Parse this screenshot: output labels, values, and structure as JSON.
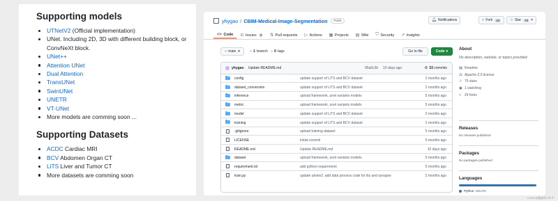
{
  "doc": {
    "heading_models": "Supporting models",
    "models": [
      {
        "link": "UTNetV2",
        "text": " (Official implementation)"
      },
      {
        "link": "",
        "text": "UNet. Including 2D, 3D with different building block, or ConvNeXt block."
      },
      {
        "link": "UNet++",
        "text": ""
      },
      {
        "link": "Attention UNet",
        "text": ""
      },
      {
        "link": "Dual Attention",
        "text": ""
      },
      {
        "link": "TransUNet",
        "text": ""
      },
      {
        "link": "SwinUNet",
        "text": ""
      },
      {
        "link": "UNETR",
        "text": ""
      },
      {
        "link": "VT-UNet",
        "text": ""
      },
      {
        "link": "",
        "text": "More models are comming soon ..."
      }
    ],
    "heading_datasets": "Supporting Datasets",
    "datasets": [
      {
        "link": "ACDC",
        "text": " Cardiac MRI"
      },
      {
        "link": "BCV",
        "text": " Abdomen Organ CT"
      },
      {
        "link": "LiTS",
        "text": " Liver and Tumor CT"
      },
      {
        "link": "",
        "text": "More datasets are comming soon"
      }
    ]
  },
  "repo": {
    "owner": "yhygao",
    "separator": "/",
    "name": "CBIM-Medical-Image-Segmentation",
    "visibility": "Public",
    "actions": {
      "notifications": "Notifications",
      "fork": "Fork",
      "fork_count": "24",
      "star": "Star",
      "star_count": "70"
    },
    "tabs": [
      {
        "label": "Code",
        "icon": "<>",
        "count": ""
      },
      {
        "label": "Issues",
        "icon": "⊙",
        "count": "3"
      },
      {
        "label": "Pull requests",
        "icon": "⇅",
        "count": ""
      },
      {
        "label": "Actions",
        "icon": "▷",
        "count": ""
      },
      {
        "label": "Projects",
        "icon": "▦",
        "count": ""
      },
      {
        "label": "Wiki",
        "icon": "▤",
        "count": ""
      },
      {
        "label": "Security",
        "icon": "⛉",
        "count": ""
      },
      {
        "label": "Insights",
        "icon": "↗",
        "count": ""
      }
    ],
    "branch": "main",
    "branch_count": "1",
    "branch_word": "branch",
    "tag_count": "0",
    "tag_word": "tags",
    "goto_file": "Go to file",
    "code_button": "Code",
    "latest_commit": {
      "author": "yhygao",
      "message": "Update README.md",
      "hash": "95a5c2b",
      "ago": "10 days ago",
      "commits_count": "33",
      "commits_word": "commits"
    },
    "files": [
      {
        "type": "dir",
        "name": "config",
        "message": "update support of LiTS and BCV dataset",
        "age": "2 months ago"
      },
      {
        "type": "dir",
        "name": "dataset_conversion",
        "message": "update support of LiTS and BCV dataset",
        "age": "2 months ago"
      },
      {
        "type": "dir",
        "name": "inference",
        "message": "upload framework, unet variants models",
        "age": "5 months ago"
      },
      {
        "type": "dir",
        "name": "metric",
        "message": "upload framework, unet variants models",
        "age": "5 months ago"
      },
      {
        "type": "dir",
        "name": "model",
        "message": "update support of LiTS and BCV dataset",
        "age": "2 months ago"
      },
      {
        "type": "dir",
        "name": "training",
        "message": "update support of LiTS and BCV dataset",
        "age": "2 months ago"
      },
      {
        "type": "file",
        "name": ".gitignore",
        "message": "upload training dataset",
        "age": "5 months ago"
      },
      {
        "type": "file",
        "name": "LICENSE",
        "message": "Initial commit",
        "age": "5 months ago"
      },
      {
        "type": "file",
        "name": "README.md",
        "message": "Update README.md",
        "age": "10 days ago"
      },
      {
        "type": "dir",
        "name": "dataset",
        "message": "upload framework, unet variants models",
        "age": "5 months ago"
      },
      {
        "type": "file",
        "name": "requirement.txt",
        "message": "add python requirement",
        "age": "5 months ago"
      },
      {
        "type": "file",
        "name": "train.py",
        "message": "update utnetv2, add data process code for lits and synapse",
        "age": "2 months ago"
      }
    ],
    "about": {
      "title": "About",
      "description": "No description, website, or topics provided.",
      "readme": "Readme",
      "license": "Apache-2.0 license",
      "stars": "70 stars",
      "watching": "1 watching",
      "forks": "24 forks"
    },
    "releases": {
      "title": "Releases",
      "text": "No releases published"
    },
    "packages": {
      "title": "Packages",
      "text": "No packages published"
    },
    "languages": {
      "title": "Languages",
      "name": "Python",
      "percent": "100.0%",
      "python_fraction": 1.0,
      "python_color": "#3572a5"
    }
  },
  "watermark": "CSDN @勤奋的小伙子"
}
